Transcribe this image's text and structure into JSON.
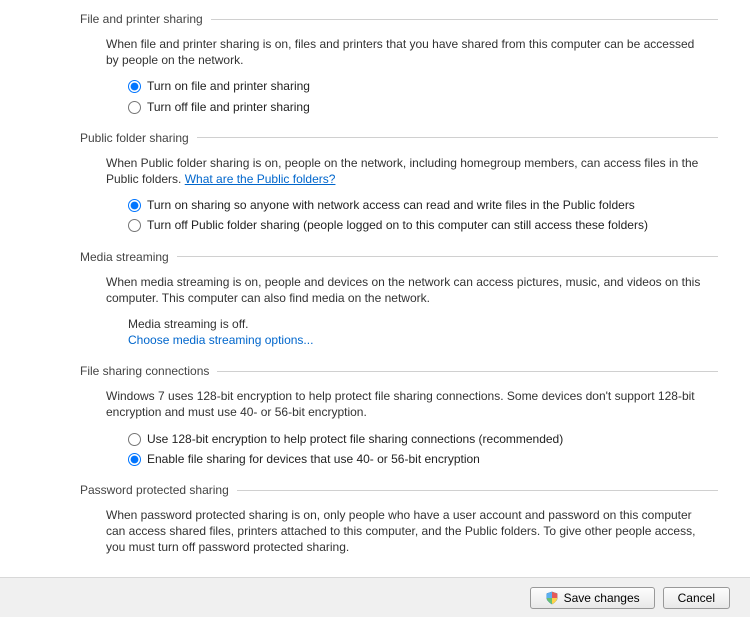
{
  "sections": {
    "filePrinter": {
      "title": "File and printer sharing",
      "description": "When file and printer sharing is on, files and printers that you have shared from this computer can be accessed by people on the network.",
      "optOn": "Turn on file and printer sharing",
      "optOff": "Turn off file and printer sharing",
      "selected": "on"
    },
    "publicFolder": {
      "title": "Public folder sharing",
      "descriptionPrefix": "When Public folder sharing is on, people on the network, including homegroup members, can access files in the Public folders. ",
      "link": "What are the Public folders?",
      "optOn": "Turn on sharing so anyone with network access can read and write files in the Public folders",
      "optOff": "Turn off Public folder sharing (people logged on to this computer can still access these folders)",
      "selected": "on"
    },
    "media": {
      "title": "Media streaming",
      "description": "When media streaming is on, people and devices on the network can access pictures, music, and videos on this computer. This computer can also find media on the network.",
      "status": "Media streaming is off.",
      "link": "Choose media streaming options..."
    },
    "fileConn": {
      "title": "File sharing connections",
      "description": "Windows 7 uses 128-bit encryption to help protect file sharing connections. Some devices don't support 128-bit encryption and must use 40- or 56-bit encryption.",
      "opt128": "Use 128-bit encryption to help protect file sharing connections (recommended)",
      "opt40": "Enable file sharing for devices that use 40- or 56-bit encryption",
      "selected": "40"
    },
    "password": {
      "title": "Password protected sharing",
      "description": "When password protected sharing is on, only people who have a user account and password on this computer can access shared files, printers attached to this computer, and the Public folders. To give other people access, you must turn off password protected sharing."
    }
  },
  "buttons": {
    "save": "Save changes",
    "cancel": "Cancel"
  }
}
